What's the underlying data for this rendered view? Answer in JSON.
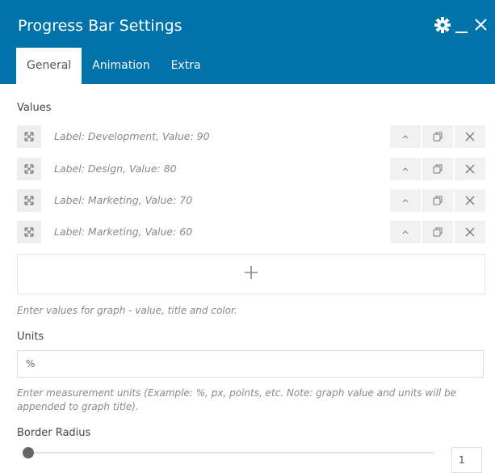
{
  "header": {
    "title": "Progress Bar Settings",
    "bg_color": "#0073aa",
    "icons": [
      "gear-icon",
      "minimize-icon",
      "close-icon"
    ]
  },
  "tabs": [
    {
      "label": "General",
      "active": true
    },
    {
      "label": "Animation",
      "active": false
    },
    {
      "label": "Extra",
      "active": false
    }
  ],
  "values": {
    "label": "Values",
    "items": [
      {
        "text": "Label: Development, Value: 90"
      },
      {
        "text": "Label: Design, Value: 80"
      },
      {
        "text": "Label: Marketing, Value: 70"
      },
      {
        "text": "Label: Marketing, Value: 60"
      }
    ],
    "hint": "Enter values for graph - value, title and color."
  },
  "units": {
    "label": "Units",
    "value": "%",
    "hint": "Enter measurement units (Example: %, px, points, etc. Note: graph value and units will be appended to graph title)."
  },
  "border_radius": {
    "label": "Border Radius",
    "value": "1"
  }
}
